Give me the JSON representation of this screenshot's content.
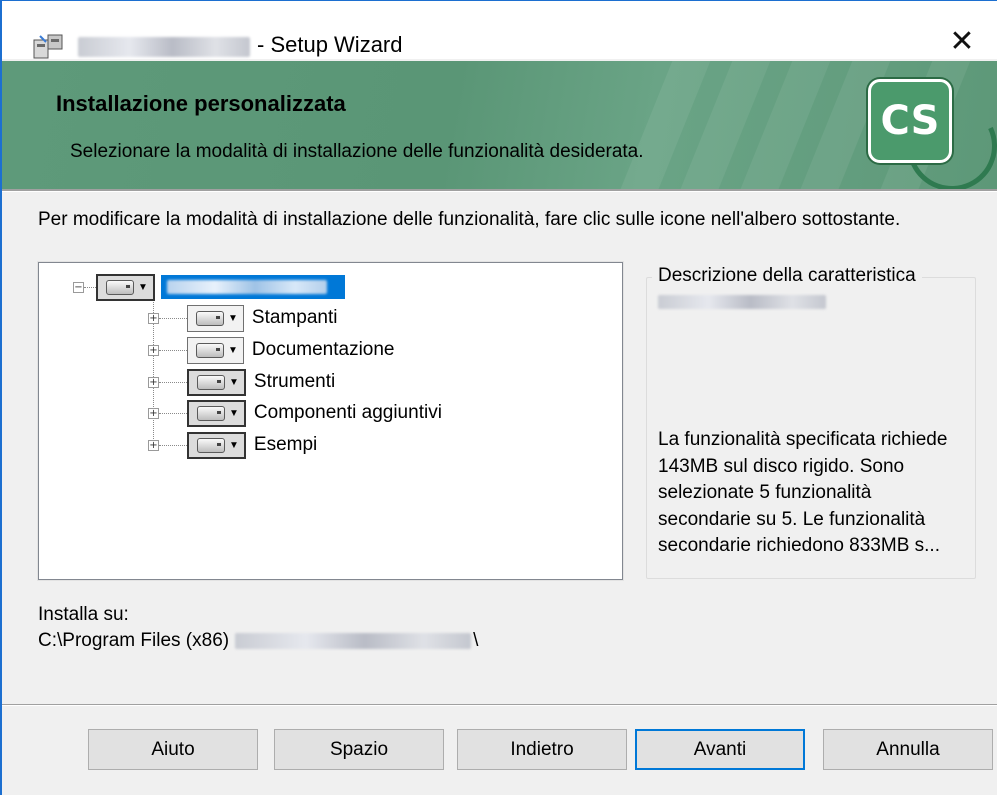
{
  "window": {
    "title": "- Setup Wizard",
    "close_glyph": "✕"
  },
  "banner": {
    "title": "Installazione personalizzata",
    "subtitle": "Selezionare la modalità di installazione delle funzionalità desiderata.",
    "logo_text": "CS",
    "color": "#5e9a7a"
  },
  "instructions": "Per modificare la modalità di installazione delle funzionalità, fare clic sulle icone nell'albero sottostante.",
  "tree": {
    "root_expander": "⊟",
    "children": [
      {
        "label": "Stampanti",
        "expander": "+"
      },
      {
        "label": "Documentazione",
        "expander": "+"
      },
      {
        "label": "Strumenti",
        "expander": "+"
      },
      {
        "label": "Componenti aggiuntivi",
        "expander": "+"
      },
      {
        "label": "Esempi",
        "expander": "+"
      }
    ]
  },
  "description": {
    "title": "Descrizione della caratteristica",
    "text": "La funzionalità specificata richiede 143MB sul disco rigido. Sono selezionate 5 funzionalità secondarie su 5. Le funzionalità secondarie richiedono 833MB s..."
  },
  "install": {
    "label": "Installa su:",
    "path_prefix": "C:\\Program Files (x86)",
    "path_suffix": "\\"
  },
  "buttons": {
    "help": "Aiuto",
    "space": "Spazio",
    "back": "Indietro",
    "next": "Avanti",
    "cancel": "Annulla"
  }
}
